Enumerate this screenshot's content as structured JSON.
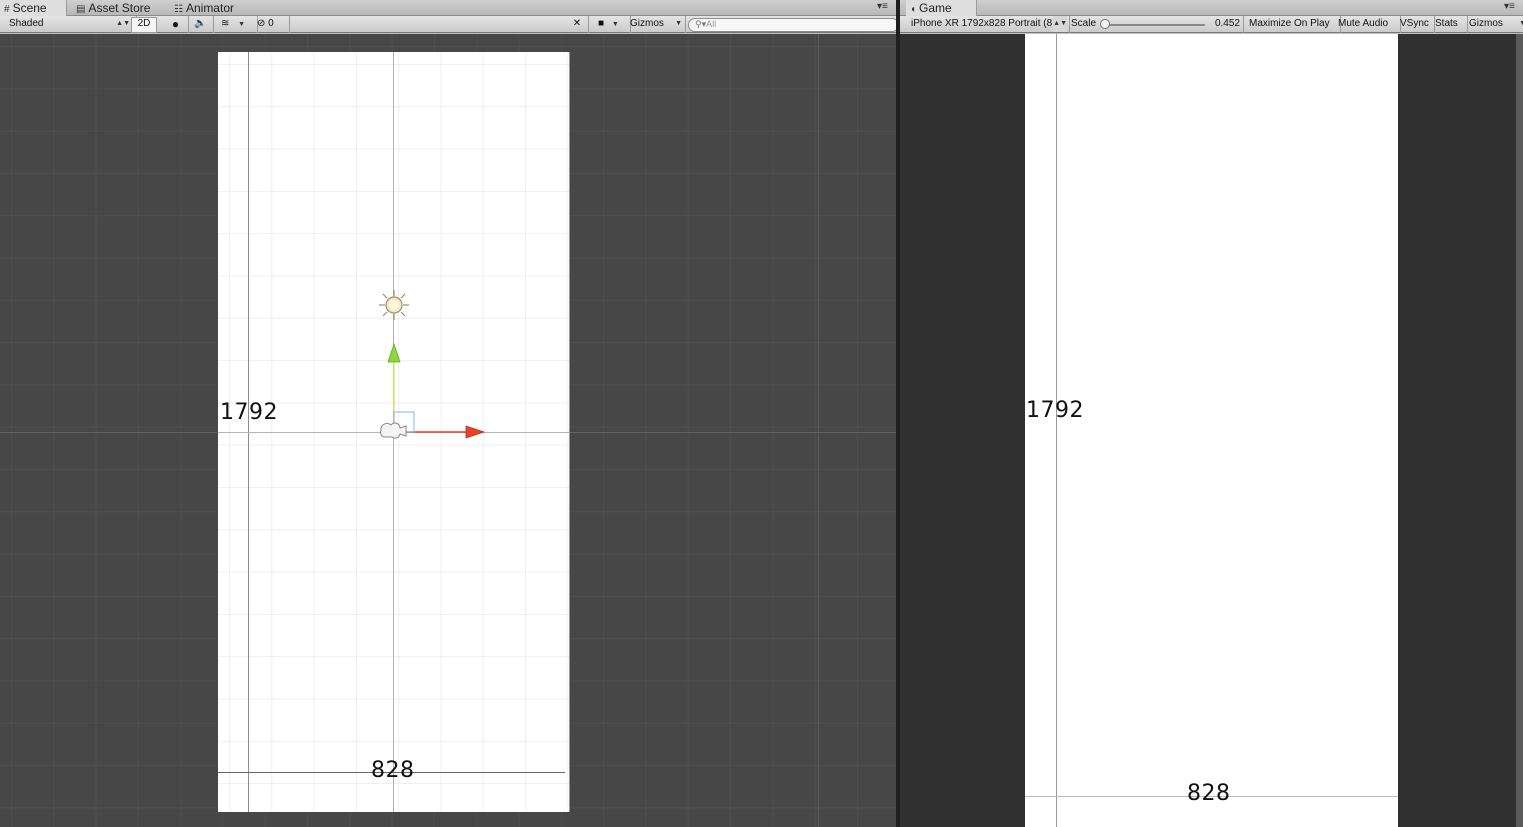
{
  "scene_panel": {
    "tabs": [
      {
        "label": "Scene",
        "icon": "hash-icon",
        "active": true
      },
      {
        "label": "Asset Store",
        "icon": "bag-icon",
        "active": false
      },
      {
        "label": "Animator",
        "icon": "animator-icon",
        "active": false
      }
    ],
    "toolbar": {
      "draw_mode": "Shaded",
      "mode_2d": "2D",
      "hidden_count": "0",
      "gizmos": "Gizmos",
      "search_placeholder": "All"
    },
    "scene": {
      "height_label": "1792",
      "width_label": "828"
    }
  },
  "game_panel": {
    "tab": {
      "label": "Game",
      "icon": "pacman-icon"
    },
    "toolbar": {
      "resolution": "iPhone XR 1792x828 Portrait (8",
      "scale_label": "Scale",
      "scale_value": "0.452",
      "scale_fraction": 0.0,
      "maximize": "Maximize On Play",
      "mute": "Mute Audio",
      "vsync": "VSync",
      "stats": "Stats",
      "gizmos": "Gizmos"
    },
    "view": {
      "height_label": "1792",
      "width_label": "828"
    }
  },
  "colors": {
    "scene_bg": "#474747",
    "game_bg": "#303030",
    "x_axis": "#e8402a",
    "y_axis": "#8fd63a"
  }
}
